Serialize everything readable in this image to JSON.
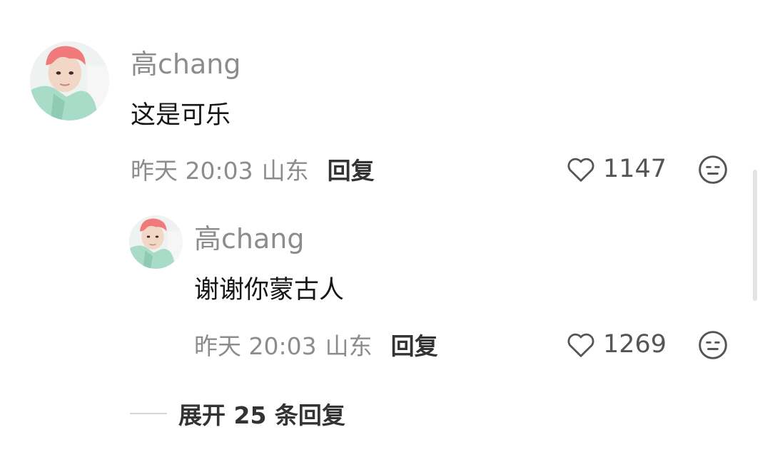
{
  "comment": {
    "username": "高chang",
    "text": "这是可乐",
    "time": "昨天 20:03",
    "location": "山东",
    "reply_label": "回复",
    "likes": "1147"
  },
  "reply": {
    "username": "高chang",
    "text": "谢谢你蒙古人",
    "time": "昨天 20:03",
    "location": "山东",
    "reply_label": "回复",
    "likes": "1269"
  },
  "expand_replies_label": "展开 25 条回复",
  "icons": {
    "like": "heart-outline-icon",
    "dislike": "meh-face-icon"
  },
  "colors": {
    "username": "#8c8c8c",
    "text": "#161616",
    "avatar_hair": "#f07a7a",
    "avatar_jacket": "#a8dcc8"
  }
}
